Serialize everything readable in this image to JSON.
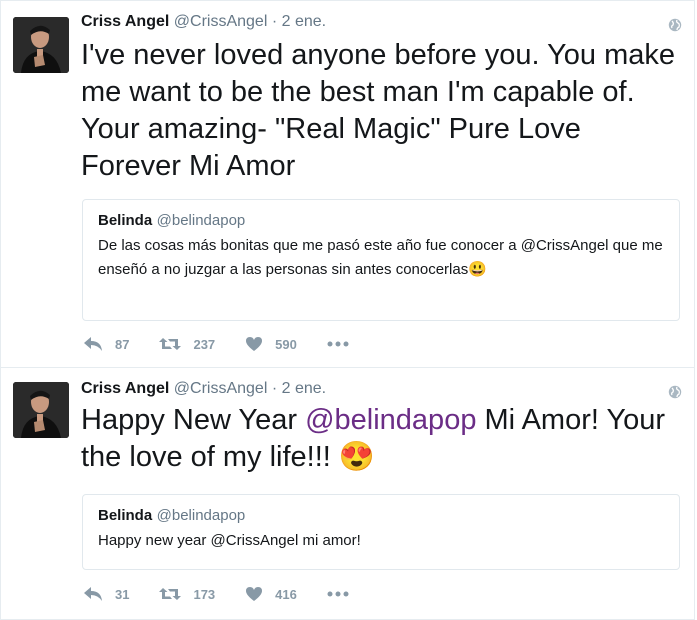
{
  "tweets": [
    {
      "author_name": "Criss Angel",
      "author_handle": "@CrissAngel",
      "date": "· 2 ene.",
      "text": "I've never loved anyone before you. You make me want to be the best man I'm capable of. Your amazing- \"Real Magic\" Pure Love Forever Mi Amor",
      "quote": {
        "author_name": "Belinda",
        "author_handle": "@belindapop",
        "text": "De las cosas más bonitas que me pasó este año fue conocer a @CrissAngel que me enseñó a no juzgar a las personas sin antes conocerlas😃"
      },
      "replies": "87",
      "retweets": "237",
      "likes": "590"
    },
    {
      "author_name": "Criss Angel",
      "author_handle": "@CrissAngel",
      "date": "· 2 ene.",
      "text_prefix": "Happy New Year ",
      "text_mention": "@belindapop",
      "text_suffix": " Mi Amor! Your the love of my life!!! 😍",
      "quote": {
        "author_name": "Belinda",
        "author_handle": "@belindapop",
        "text": "Happy new year @CrissAngel mi amor!"
      },
      "replies": "31",
      "retweets": "173",
      "likes": "416"
    }
  ],
  "icons": {
    "reply": "reply-icon",
    "retweet": "retweet-icon",
    "like": "heart-icon",
    "more": "more-icon",
    "globe": "globe-icon"
  },
  "colors": {
    "mention": "#6b2d86",
    "muted": "#8899a6",
    "border": "#e6ecf0"
  }
}
